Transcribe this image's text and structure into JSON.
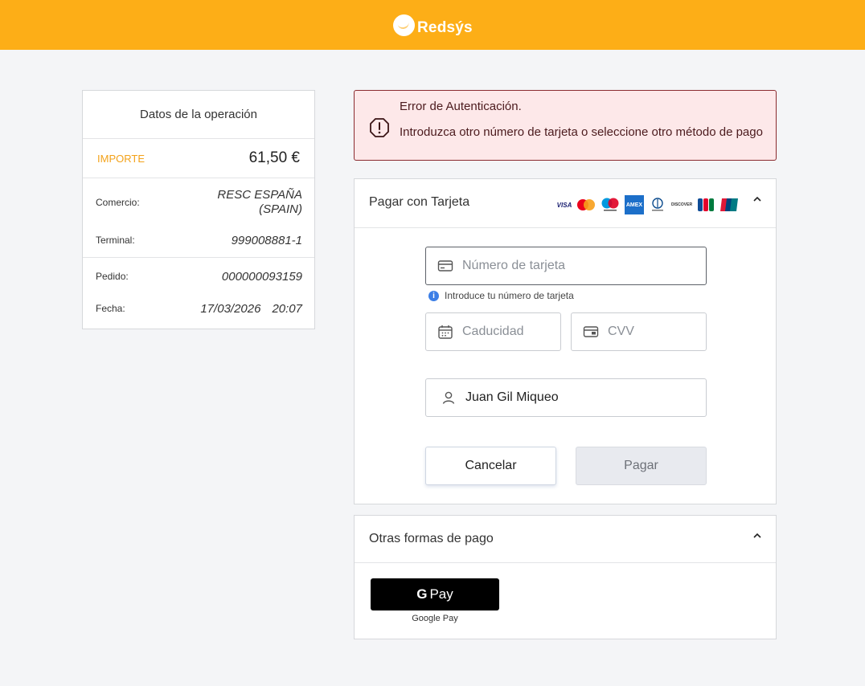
{
  "header": {
    "logo_text": "Redsýs",
    "brand_color": "#fdae17"
  },
  "summary": {
    "title": "Datos de la operación",
    "importe_label": "IMPORTE",
    "importe_value": "61,50 €",
    "comercio_label": "Comercio:",
    "comercio_value": "RESC ESPAÑA (SPAIN)",
    "terminal_label": "Terminal:",
    "terminal_value": "999008881-1",
    "pedido_label": "Pedido:",
    "pedido_value": "000000093159",
    "fecha_label": "Fecha:",
    "fecha_date": "17/03/2026",
    "fecha_time": "20:07"
  },
  "alert": {
    "title": "Error de Autenticación.",
    "message": "Introduzca otro número de tarjeta o seleccione otro método de pago",
    "icon": "warning-icon",
    "color": "#8a2b2f"
  },
  "card_payment": {
    "title": "Pagar con Tarjeta",
    "brands": [
      "visa",
      "mastercard",
      "maestro",
      "amex",
      "diners",
      "discover",
      "jcb",
      "unionpay"
    ],
    "visa_label": "VISA",
    "amex_label": "AMEX",
    "discover_label": "DISCOVER",
    "jcb_label": "JCB",
    "card_number_placeholder": "Número de tarjeta",
    "card_number_value": "",
    "card_number_helper": "Introduce tu número de tarjeta",
    "expiry_placeholder": "Caducidad",
    "expiry_value": "",
    "cvv_placeholder": "CVV",
    "cvv_value": "",
    "holder_value": "Juan Gil Miqueo",
    "cancel_label": "Cancelar",
    "pay_label": "Pagar"
  },
  "other_payments": {
    "title": "Otras formas de pago",
    "gpay_g": "G",
    "gpay_label": "Pay",
    "gpay_caption": "Google Pay"
  }
}
